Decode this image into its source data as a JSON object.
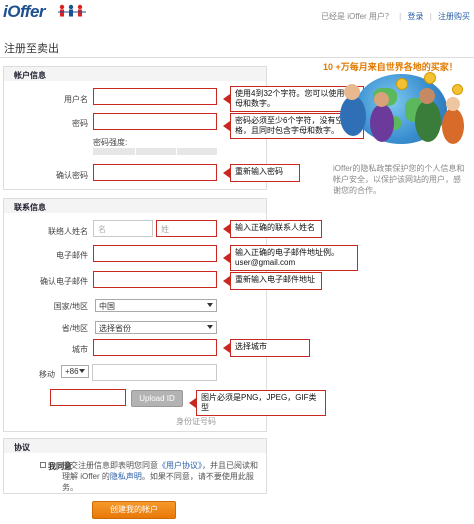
{
  "header": {
    "logo_text": "iOffer",
    "already_user": "已经是 iOffer 用户？",
    "login_link": "登录",
    "separator": "|",
    "help_link": "注册购买"
  },
  "page_title": "注册至卖出",
  "account_section": {
    "title": "帐户信息",
    "username_label": "用户名",
    "password_label": "密码",
    "strength_label": "密码强度:",
    "confirm_label": "确认密码"
  },
  "contact_section": {
    "title": "联系信息",
    "name_label": "联络人姓名",
    "first_placeholder": "名",
    "last_placeholder": "姓",
    "email_label": "电子邮件",
    "confirm_email_label": "确认电子邮件",
    "country_label": "国家/地区",
    "country_value": "中国",
    "province_label": "省/地区",
    "province_value": "选择省份",
    "city_label": "城市",
    "mobile_label": "移动",
    "mobile_code": "+86",
    "upload_label": "Upload ID",
    "id_caption": "身份证号码"
  },
  "agreement_section": {
    "title": "协议",
    "agree_label": "我同意",
    "text_before": "提交注册信息即表明您同意",
    "user_agreement": "《用户协议》",
    "text_middle": "，并且已阅读和理解 iOffer 的",
    "privacy": "隐私声明",
    "text_after": "。如果不同意，请不要使用此服务。"
  },
  "submit_button": "创建我的帐户",
  "tips": {
    "username": "使用4到32个字符。您可以使用字母和数字。",
    "password": "密码必须至少6个字符，没有空格，且同时包含字母和数字。",
    "confirm_password": "重新输入密码",
    "name": "输入正确的联系人姓名",
    "email_line1": "输入正确的电子邮件地址例。",
    "email_line2": "user@gmail.com",
    "confirm_email": "重新输入电子邮件地址",
    "city": "选择城市",
    "upload": "图片必须是PNG，JPEG，GIF类型"
  },
  "promo": {
    "title": "10 +万每月来自世界各地的买家！",
    "text": "iOffer的隐私政策保护您的个人信息和帐户安全，以保护该网站的用户，感谢您的合作。"
  },
  "colors": {
    "accent_orange": "#e9780a",
    "error_red": "#c8281f",
    "link_blue": "#2a5fa8"
  }
}
